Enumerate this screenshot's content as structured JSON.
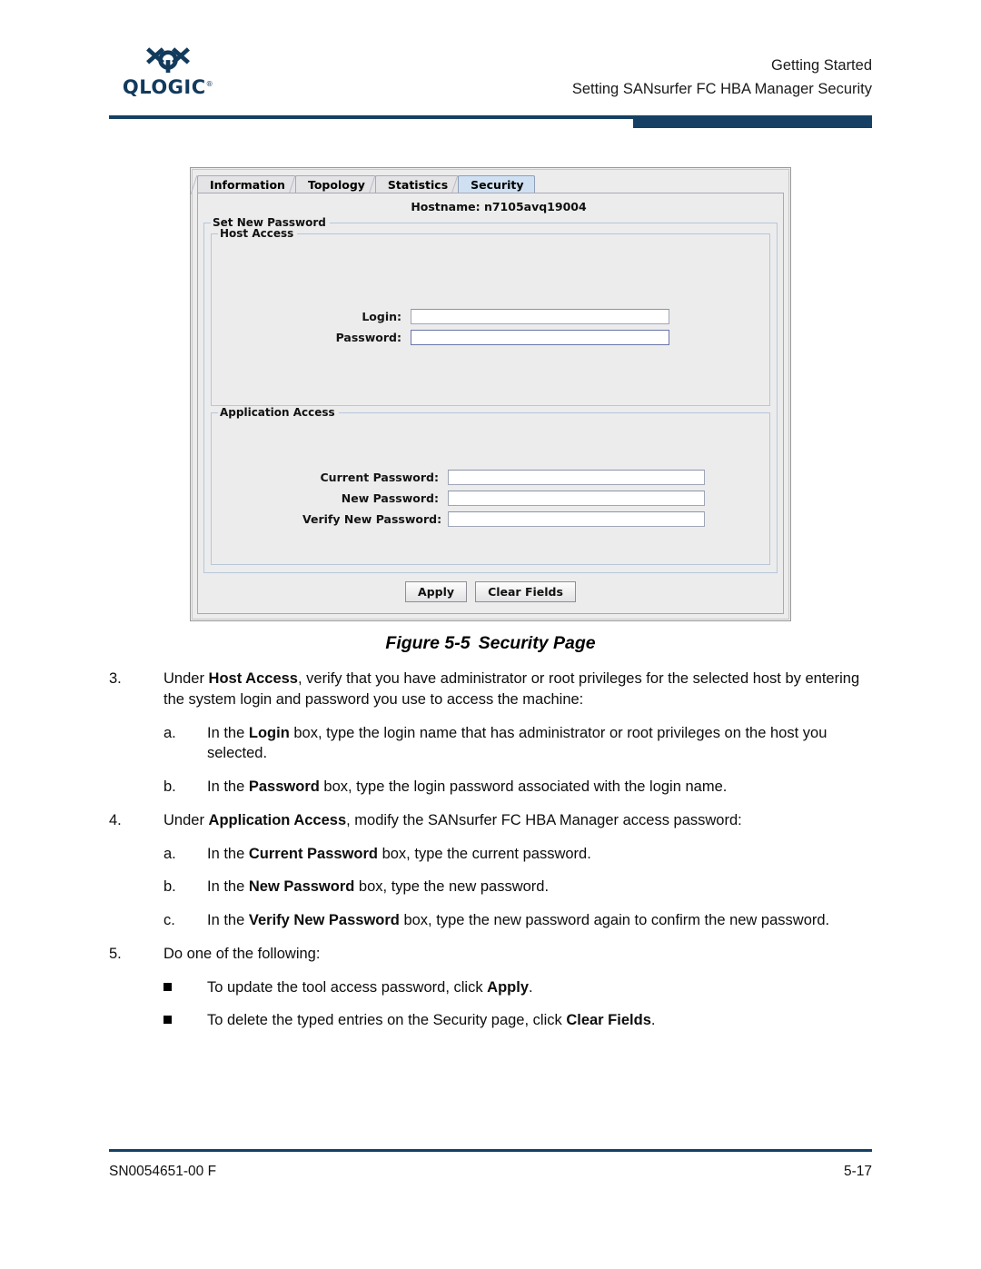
{
  "header": {
    "logo_word": "QLOGIC",
    "logo_reg": "®",
    "line1": "Getting Started",
    "line2": "Setting SANsurfer FC HBA Manager Security"
  },
  "screenshot": {
    "tabs": [
      {
        "label": "Information",
        "selected": false
      },
      {
        "label": "Topology",
        "selected": false
      },
      {
        "label": "Statistics",
        "selected": false
      },
      {
        "label": "Security",
        "selected": true
      }
    ],
    "hostname": "Hostname:  n7105avq19004",
    "set_new_password_title": "Set New Password",
    "host_access": {
      "title": "Host Access",
      "fields": [
        {
          "label": "Login:",
          "value": "",
          "focused": false
        },
        {
          "label": "Password:",
          "value": "",
          "focused": true
        }
      ]
    },
    "application_access": {
      "title": "Application Access",
      "fields": [
        {
          "label": "Current Password:",
          "value": "",
          "focused": false
        },
        {
          "label": "New Password:",
          "value": "",
          "focused": false
        },
        {
          "label": "Verify New Password:",
          "value": "",
          "focused": false
        }
      ]
    },
    "buttons": [
      {
        "label": "Apply"
      },
      {
        "label": "Clear Fields"
      }
    ]
  },
  "figure": {
    "number": "Figure 5-5",
    "title": "Security Page"
  },
  "steps": [
    {
      "level": 1,
      "marker": "3.",
      "parts": [
        {
          "t": "Under ",
          "b": false
        },
        {
          "t": "Host Access",
          "b": true
        },
        {
          "t": ", verify that you have administrator or root privileges for the selected host by entering the system login and password you use to access the machine:",
          "b": false
        }
      ]
    },
    {
      "level": 2,
      "marker": "a.",
      "parts": [
        {
          "t": "In the ",
          "b": false
        },
        {
          "t": "Login",
          "b": true
        },
        {
          "t": " box, type the login name that has administrator or root privileges on the host you selected.",
          "b": false
        }
      ]
    },
    {
      "level": 2,
      "marker": "b.",
      "parts": [
        {
          "t": "In the ",
          "b": false
        },
        {
          "t": "Password",
          "b": true
        },
        {
          "t": " box, type the login password associated with the login name.",
          "b": false
        }
      ]
    },
    {
      "level": 1,
      "marker": "4.",
      "parts": [
        {
          "t": "Under ",
          "b": false
        },
        {
          "t": "Application Access",
          "b": true
        },
        {
          "t": ", modify the SANsurfer FC HBA Manager access password:",
          "b": false
        }
      ]
    },
    {
      "level": 2,
      "marker": "a.",
      "parts": [
        {
          "t": "In the ",
          "b": false
        },
        {
          "t": "Current Password",
          "b": true
        },
        {
          "t": " box, type the current password.",
          "b": false
        }
      ]
    },
    {
      "level": 2,
      "marker": "b.",
      "parts": [
        {
          "t": "In the ",
          "b": false
        },
        {
          "t": "New Password",
          "b": true
        },
        {
          "t": " box, type the new password.",
          "b": false
        }
      ]
    },
    {
      "level": 2,
      "marker": "c.",
      "parts": [
        {
          "t": "In the ",
          "b": false
        },
        {
          "t": "Verify New Password",
          "b": true
        },
        {
          "t": " box, type the new password again to confirm the new password.",
          "b": false
        }
      ]
    },
    {
      "level": 1,
      "marker": "5.",
      "parts": [
        {
          "t": "Do one of the following:",
          "b": false
        }
      ]
    },
    {
      "level": "bullet",
      "marker": "■",
      "parts": [
        {
          "t": "To update the tool access password, click ",
          "b": false
        },
        {
          "t": "Apply",
          "b": true
        },
        {
          "t": ".",
          "b": false
        }
      ]
    },
    {
      "level": "bullet",
      "marker": "■",
      "parts": [
        {
          "t": "To delete the typed entries on the Security page, click ",
          "b": false
        },
        {
          "t": "Clear Fields",
          "b": true
        },
        {
          "t": ".",
          "b": false
        }
      ]
    }
  ],
  "footer": {
    "doc_id": "SN0054651-00  F",
    "page_number": "5-17"
  },
  "colors": {
    "brand": "#154063",
    "panel": "#ececed",
    "tab_selected": "#cfe0f2"
  }
}
